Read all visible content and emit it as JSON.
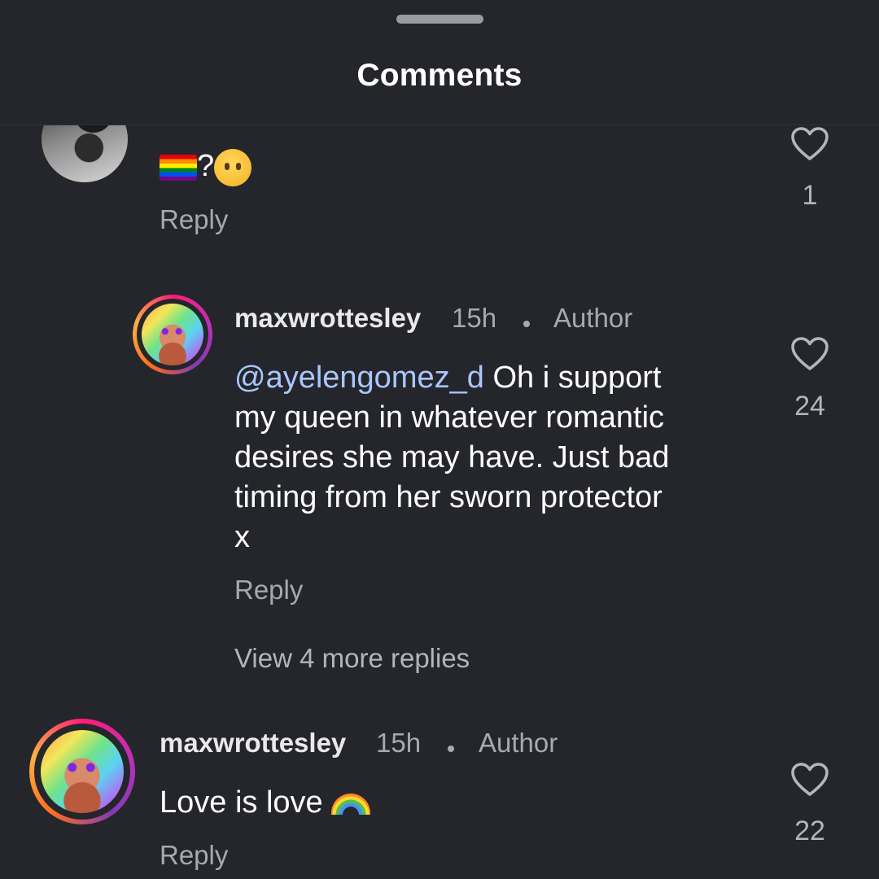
{
  "sheet": {
    "title": "Comments"
  },
  "comments": [
    {
      "text_prefix": "",
      "text": "?",
      "reply_label": "Reply",
      "likes": "1"
    },
    {
      "username": "maxwrottesley",
      "time": "15h",
      "badge": "Author",
      "mention": "@ayelengomez_d",
      "text_lines": [
        "Oh i support",
        "my queen in whatever romantic",
        "desires she may have. Just bad",
        "timing from her sworn protector",
        "x"
      ],
      "reply_label": "Reply",
      "likes": "24"
    },
    {
      "username": "maxwrottesley",
      "time": "15h",
      "badge": "Author",
      "text": "Love is love",
      "reply_label": "Reply",
      "likes": "22"
    }
  ],
  "view_more_label": "View 4 more replies",
  "icons": {
    "like": "heart-outline-icon",
    "flag": "rainbow-flag-emoji",
    "face": "face-with-raised-eyebrow-emoji",
    "rainbow": "rainbow-emoji"
  },
  "colors": {
    "background": "#25262b",
    "mention": "#a8c7ff",
    "meta": "#a8a9ae"
  }
}
